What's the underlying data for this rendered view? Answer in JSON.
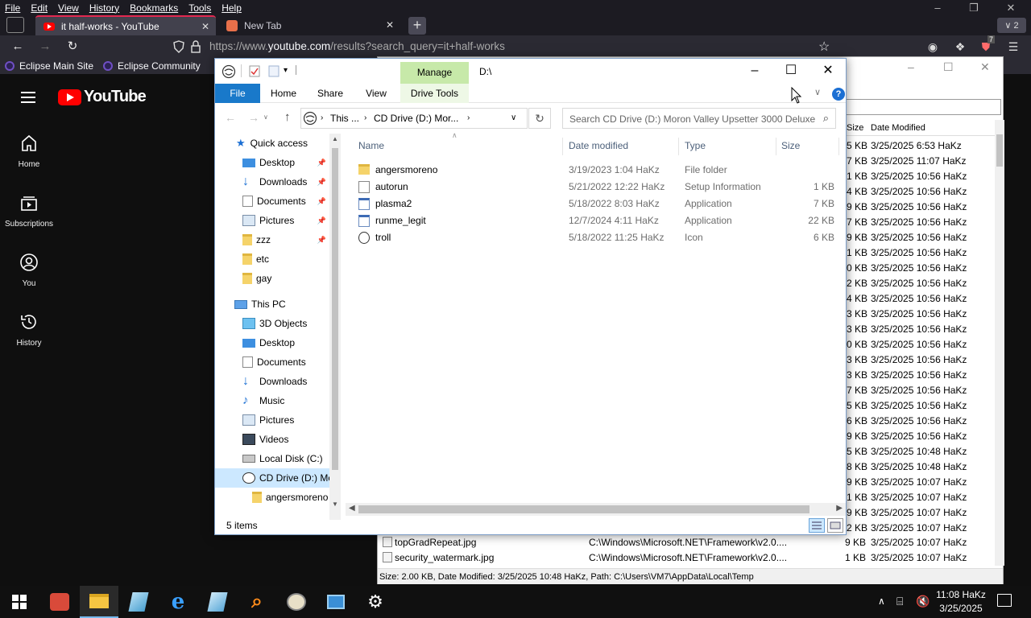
{
  "firefox": {
    "menu": [
      "File",
      "Edit",
      "View",
      "History",
      "Bookmarks",
      "Tools",
      "Help"
    ],
    "tabs": [
      {
        "title": "it half-works - YouTube",
        "active": true
      },
      {
        "title": "New Tab",
        "active": false
      }
    ],
    "all_tabs_count": "2",
    "url_prefix": "https://www.",
    "url_domain": "youtube.com",
    "url_rest": "/results?search_query=it+half-works",
    "extension_badge": "7",
    "bookmarks": [
      "Eclipse Main Site",
      "Eclipse Community"
    ]
  },
  "youtube": {
    "logo_text": "YouTube",
    "guide": [
      {
        "label": "Home",
        "icon": "home-icon"
      },
      {
        "label": "Subscriptions",
        "icon": "subscriptions-icon"
      },
      {
        "label": "You",
        "icon": "you-icon"
      },
      {
        "label": "History",
        "icon": "history-icon"
      }
    ]
  },
  "background_window": {
    "columns": {
      "size": "Size",
      "date": "Date Modified"
    },
    "rows": [
      {
        "size": "5 KB",
        "date": "3/25/2025 6:53 HaKz"
      },
      {
        "size": "7 KB",
        "date": "3/25/2025 11:07 HaKz"
      },
      {
        "size": "1 KB",
        "date": "3/25/2025 10:56 HaKz"
      },
      {
        "size": "4 KB",
        "date": "3/25/2025 10:56 HaKz"
      },
      {
        "size": "9 KB",
        "date": "3/25/2025 10:56 HaKz"
      },
      {
        "size": "7 KB",
        "date": "3/25/2025 10:56 HaKz"
      },
      {
        "size": "9 KB",
        "date": "3/25/2025 10:56 HaKz"
      },
      {
        "size": "1 KB",
        "date": "3/25/2025 10:56 HaKz"
      },
      {
        "size": "0 KB",
        "date": "3/25/2025 10:56 HaKz"
      },
      {
        "size": "2 KB",
        "date": "3/25/2025 10:56 HaKz"
      },
      {
        "size": "4 KB",
        "date": "3/25/2025 10:56 HaKz"
      },
      {
        "size": "3 KB",
        "date": "3/25/2025 10:56 HaKz"
      },
      {
        "size": "3 KB",
        "date": "3/25/2025 10:56 HaKz"
      },
      {
        "size": "0 KB",
        "date": "3/25/2025 10:56 HaKz"
      },
      {
        "size": "3 KB",
        "date": "3/25/2025 10:56 HaKz"
      },
      {
        "size": "3 KB",
        "date": "3/25/2025 10:56 HaKz"
      },
      {
        "size": "7 KB",
        "date": "3/25/2025 10:56 HaKz"
      },
      {
        "size": "5 KB",
        "date": "3/25/2025 10:56 HaKz"
      },
      {
        "size": "6 KB",
        "date": "3/25/2025 10:56 HaKz"
      },
      {
        "size": "9 KB",
        "date": "3/25/2025 10:56 HaKz"
      },
      {
        "size": "5 KB",
        "date": "3/25/2025 10:48 HaKz"
      },
      {
        "size": "8 KB",
        "date": "3/25/2025 10:48 HaKz"
      },
      {
        "size": "9 KB",
        "date": "3/25/2025 10:07 HaKz"
      },
      {
        "size": "1 KB",
        "date": "3/25/2025 10:07 HaKz"
      },
      {
        "size": "9 KB",
        "date": "3/25/2025 10:07 HaKz"
      },
      {
        "size": "2 KB",
        "date": "3/25/2025 10:07 HaKz"
      }
    ],
    "bottom_rows": [
      {
        "name": "topGradRepeat.jpg",
        "path": "C:\\Windows\\Microsoft.NET\\Framework\\v2.0....",
        "size": "9 KB",
        "date": "3/25/2025 10:07 HaKz"
      },
      {
        "name": "security_watermark.jpg",
        "path": "C:\\Windows\\Microsoft.NET\\Framework\\v2.0....",
        "size": "1 KB",
        "date": "3/25/2025 10:07 HaKz"
      }
    ],
    "status": "Size: 2.00 KB, Date Modified: 3/25/2025 10:48 HaKz, Path: C:\\Users\\VM7\\AppData\\Local\\Temp"
  },
  "explorer": {
    "manage_tab": "Manage",
    "drive_path": "D:\\",
    "ribbon_tabs": [
      "File",
      "Home",
      "Share",
      "View"
    ],
    "drive_tools": "Drive Tools",
    "help_glyph": "?",
    "address_segments": [
      "This ...",
      "CD Drive (D:) Mor..."
    ],
    "search_placeholder": "Search CD Drive (D:) Moron Valley Upsetter 3000 Deluxe",
    "columns": {
      "name": "Name",
      "date": "Date modified",
      "type": "Type",
      "size": "Size"
    },
    "files": [
      {
        "name": "angersmoreno",
        "date": "3/19/2023 1:04 HaKz",
        "type": "File folder",
        "size": "",
        "icon": "folder-icon"
      },
      {
        "name": "autorun",
        "date": "5/21/2022 12:22 HaKz",
        "type": "Setup Information",
        "size": "1 KB",
        "icon": "setup-file-icon"
      },
      {
        "name": "plasma2",
        "date": "5/18/2022 8:03 HaKz",
        "type": "Application",
        "size": "7 KB",
        "icon": "application-icon"
      },
      {
        "name": "runme_legit",
        "date": "12/7/2024 4:11 HaKz",
        "type": "Application",
        "size": "22 KB",
        "icon": "application-icon"
      },
      {
        "name": "troll",
        "date": "5/18/2022 11:25 HaKz",
        "type": "Icon",
        "size": "6 KB",
        "icon": "troll-icon"
      }
    ],
    "nav": {
      "quick_access": "Quick access",
      "quick_items": [
        {
          "label": "Desktop",
          "icon": "desktop-icon",
          "pinned": true
        },
        {
          "label": "Downloads",
          "icon": "downloads-icon",
          "pinned": true
        },
        {
          "label": "Documents",
          "icon": "documents-icon",
          "pinned": true
        },
        {
          "label": "Pictures",
          "icon": "pictures-icon",
          "pinned": true
        },
        {
          "label": "zzz",
          "icon": "folder-icon",
          "pinned": true
        },
        {
          "label": "etc",
          "icon": "folder-icon",
          "pinned": false
        },
        {
          "label": "gay",
          "icon": "folder-icon",
          "pinned": false
        }
      ],
      "this_pc": "This PC",
      "pc_items": [
        {
          "label": "3D Objects",
          "icon": "3d-objects-icon"
        },
        {
          "label": "Desktop",
          "icon": "desktop-icon"
        },
        {
          "label": "Documents",
          "icon": "documents-icon"
        },
        {
          "label": "Downloads",
          "icon": "downloads-icon"
        },
        {
          "label": "Music",
          "icon": "music-icon"
        },
        {
          "label": "Pictures",
          "icon": "pictures-icon"
        },
        {
          "label": "Videos",
          "icon": "videos-icon"
        },
        {
          "label": "Local Disk (C:)",
          "icon": "local-disk-icon"
        },
        {
          "label": "CD Drive (D:) Mo",
          "icon": "cd-drive-icon"
        },
        {
          "label": "angersmoreno",
          "icon": "folder-icon"
        }
      ]
    },
    "status": "5 items"
  },
  "taskbar": {
    "time": "11:08 HaKz",
    "date": "3/25/2025"
  },
  "colors": {
    "firefox_chrome": "#1c1b22",
    "youtube_bg": "#0f0f0f",
    "youtube_red": "#ff0000",
    "explorer_accent": "#1979ca",
    "manage_green": "#c7e9a9"
  }
}
